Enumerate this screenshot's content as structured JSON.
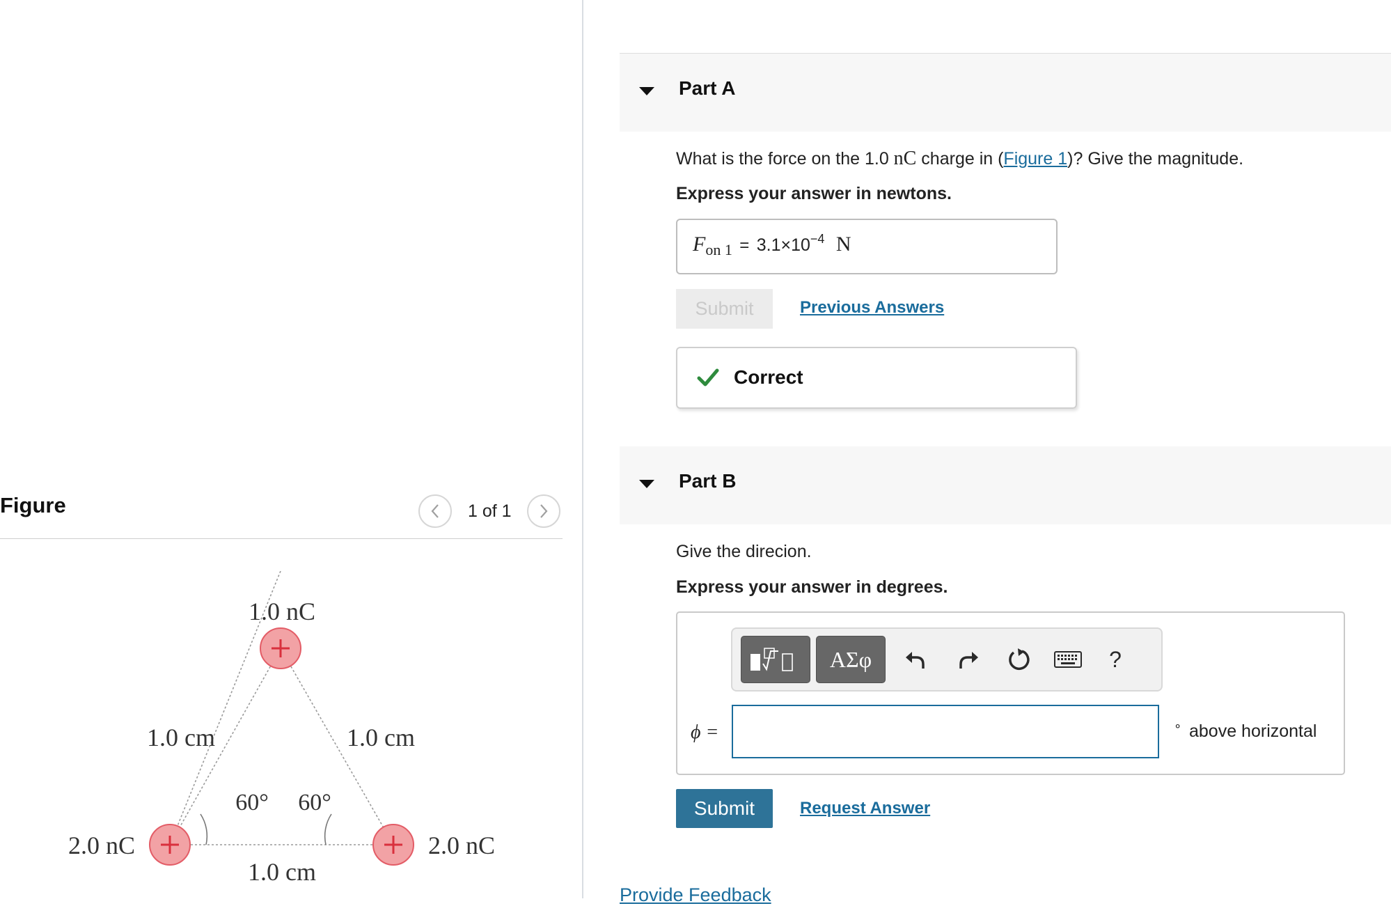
{
  "figure_panel": {
    "title": "Figure",
    "counter": "1 of 1",
    "diagram": {
      "top_charge": "1.0 nC",
      "left_charge": "2.0 nC",
      "right_charge": "2.0 nC",
      "left_side": "1.0 cm",
      "right_side": "1.0 cm",
      "bottom_side": "1.0 cm",
      "left_angle": "60°",
      "right_angle": "60°",
      "charge_sign": "+"
    }
  },
  "part_a": {
    "title": "Part A",
    "question_prefix": "What is the force on the 1.0 ",
    "question_unit": "nC",
    "question_mid": " charge in (",
    "question_link": "Figure 1",
    "question_suffix": ")? Give the magnitude.",
    "instruction": "Express your answer in newtons.",
    "answer_var": "F",
    "answer_sub": "on 1",
    "answer_eq": "=",
    "answer_mantissa": "3.1×10",
    "answer_exp": "−4",
    "answer_unit": "N",
    "submit_label": "Submit",
    "previous_answers_label": "Previous Answers",
    "feedback_label": "Correct"
  },
  "part_b": {
    "title": "Part B",
    "question": "Give the direcion.",
    "instruction": "Express your answer in degrees.",
    "toolbar": {
      "greek_label": "ΑΣφ",
      "help_label": "?"
    },
    "answer_label": "ϕ =",
    "answer_value": "",
    "degree_symbol": "∘",
    "unit_label": "above horizontal",
    "submit_label": "Submit",
    "request_answer_label": "Request Answer"
  },
  "footer": {
    "feedback_link": "Provide Feedback"
  },
  "colors": {
    "accent": "#2e7398",
    "link": "#1a6c9c",
    "correct_check": "#2e8b3d",
    "charge_fill": "#f2a2a5",
    "charge_stroke": "#e04a55"
  }
}
